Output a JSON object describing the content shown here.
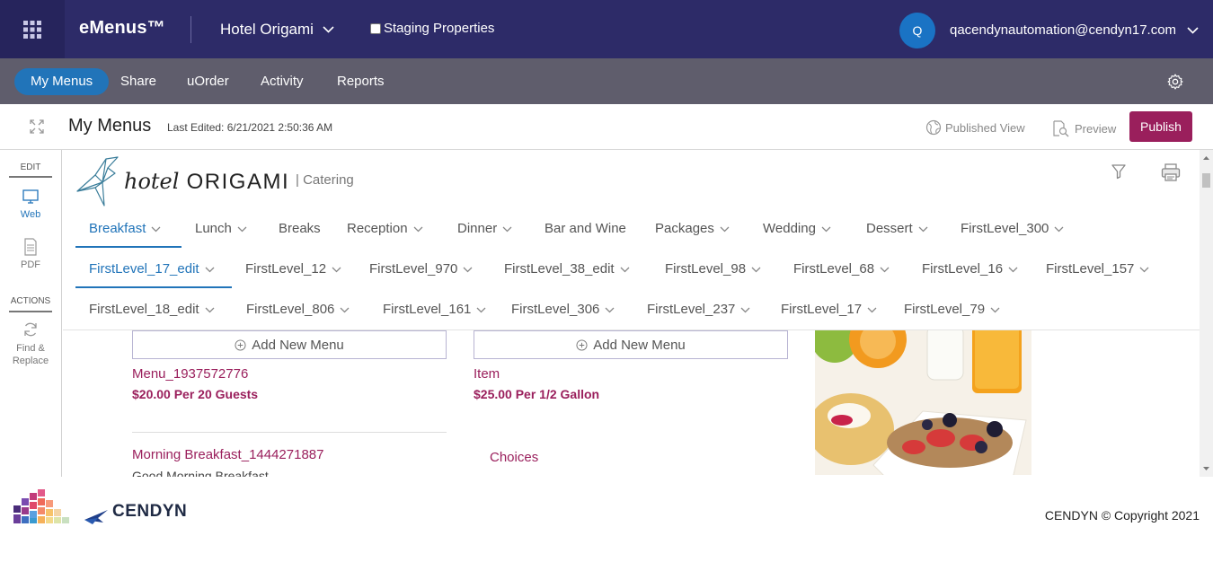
{
  "header": {
    "app_name": "eMenus™",
    "hotel": "Hotel Origami",
    "staging_label": "Staging Properties",
    "staging_checked": false,
    "avatar_initial": "Q",
    "user_email": "qacendynautomation@cendyn17.com"
  },
  "nav": {
    "items": [
      "My Menus",
      "Share",
      "uOrder",
      "Activity",
      "Reports"
    ],
    "active": "My Menus"
  },
  "subheader": {
    "title": "My Menus",
    "last_edited": "Last Edited: 6/21/2021 2:50:36 AM",
    "published_view": "Published View",
    "preview": "Preview",
    "publish": "Publish"
  },
  "sidebar": {
    "edit_label": "EDIT",
    "web": "Web",
    "pdf": "PDF",
    "actions_label": "ACTIONS",
    "find_replace_1": "Find &",
    "find_replace_2": "Replace"
  },
  "brand_logo": {
    "word_hotel": "hotel",
    "word_origami": "ORIGAMI",
    "section": "| Catering"
  },
  "tabs": {
    "row1": [
      "Breakfast",
      "Lunch",
      "Breaks",
      "Reception",
      "Dinner",
      "Bar and Wine",
      "Packages",
      "Wedding",
      "Dessert",
      "FirstLevel_300"
    ],
    "row2": [
      "FirstLevel_17_edit",
      "FirstLevel_12",
      "FirstLevel_970",
      "FirstLevel_38_edit",
      "FirstLevel_98",
      "FirstLevel_68",
      "FirstLevel_16",
      "FirstLevel_157"
    ],
    "row3": [
      "FirstLevel_18_edit",
      "FirstLevel_806",
      "FirstLevel_161",
      "FirstLevel_306",
      "FirstLevel_237",
      "FirstLevel_17",
      "FirstLevel_79"
    ]
  },
  "menu": {
    "add_new_menu": "Add New Menu",
    "col1": {
      "item1_title": "Menu_1937572776",
      "item1_price": "$20.00 Per 20 Guests",
      "item2_title": "Morning Breakfast_1444271887",
      "item2_desc": "Good Morning Breakfast"
    },
    "col2": {
      "item1_title": "Item",
      "item1_price": "$25.00 Per 1/2 Gallon",
      "choices": "Choices"
    }
  },
  "footer": {
    "brand": "CENDYN",
    "copyright": "CENDYN © Copyright 2021"
  },
  "colors": {
    "topbar": "#2d2b68",
    "navbar": "#5f5d6c",
    "accent_blue": "#2174b9",
    "brand_magenta": "#9a1f5c"
  }
}
